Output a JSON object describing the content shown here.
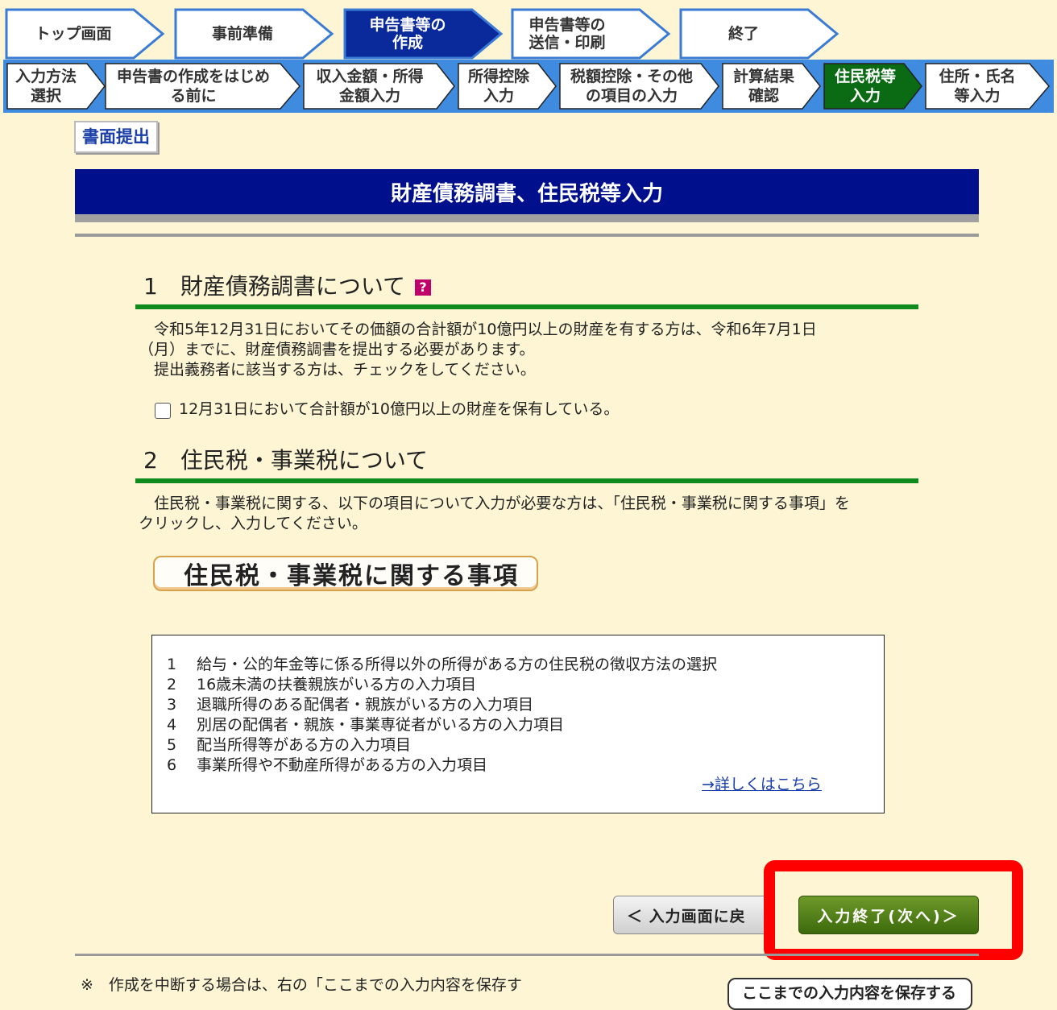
{
  "steps": [
    {
      "label": "トップ画面"
    },
    {
      "label": "事前準備"
    },
    {
      "label": "申告書等の\n作成"
    },
    {
      "label": "申告書等の\n送信・印刷"
    },
    {
      "label": "終了"
    }
  ],
  "substeps": [
    {
      "label": "入力方法\n選択"
    },
    {
      "label": "申告書の作成をはじめ\nる前に"
    },
    {
      "label": "収入金額・所得\n金額入力"
    },
    {
      "label": "所得控除\n入力"
    },
    {
      "label": "税額控除・その他\nの項目の入力"
    },
    {
      "label": "計算結果\n確認"
    },
    {
      "label": "住民税等\n入力"
    },
    {
      "label": "住所・氏名\n等入力"
    }
  ],
  "shomen_label": "書面提出",
  "page_title": "財産債務調書、住民税等入力",
  "section1": {
    "heading": "1　財産債務調書について",
    "help_icon": "?",
    "body_line1": "　令和5年12月31日においてその価額の合計額が10億円以上の財産を有する方は、令和6年7月1日",
    "body_line2": "（月）までに、財産債務調書を提出する必要があります。",
    "body_line3": "　提出義務者に該当する方は、チェックをしてください。",
    "checkbox_label": "12月31日において合計額が10億円以上の財産を保有している。"
  },
  "section2": {
    "heading": "2　住民税・事業税について",
    "body_line1": "　住民税・事業税に関する、以下の項目について入力が必要な方は、「住民税・事業税に関する事項」を",
    "body_line2": "クリックし、入力してください。",
    "button_label": "住民税・事業税に関する事項"
  },
  "items": [
    {
      "num": "1",
      "text": "給与・公的年金等に係る所得以外の所得がある方の住民税の徴収方法の選択"
    },
    {
      "num": "2",
      "text": "16歳未満の扶養親族がいる方の入力項目"
    },
    {
      "num": "3",
      "text": "退職所得のある配偶者・親族がいる方の入力項目"
    },
    {
      "num": "4",
      "text": "別居の配偶者・親族・事業専従者がいる方の入力項目"
    },
    {
      "num": "5",
      "text": "配当所得等がある方の入力項目"
    },
    {
      "num": "6",
      "text": "事業所得や不動産所得がある方の入力項目"
    }
  ],
  "detail_link": "→詳しくはこちら",
  "back_button": "＜ 入力画面に戻",
  "next_button": "入力終了(次へ)＞",
  "note_text": "※　作成を中断する場合は、右の「ここまでの入力内容を保存す",
  "save_button": "ここまでの入力内容を保存する"
}
